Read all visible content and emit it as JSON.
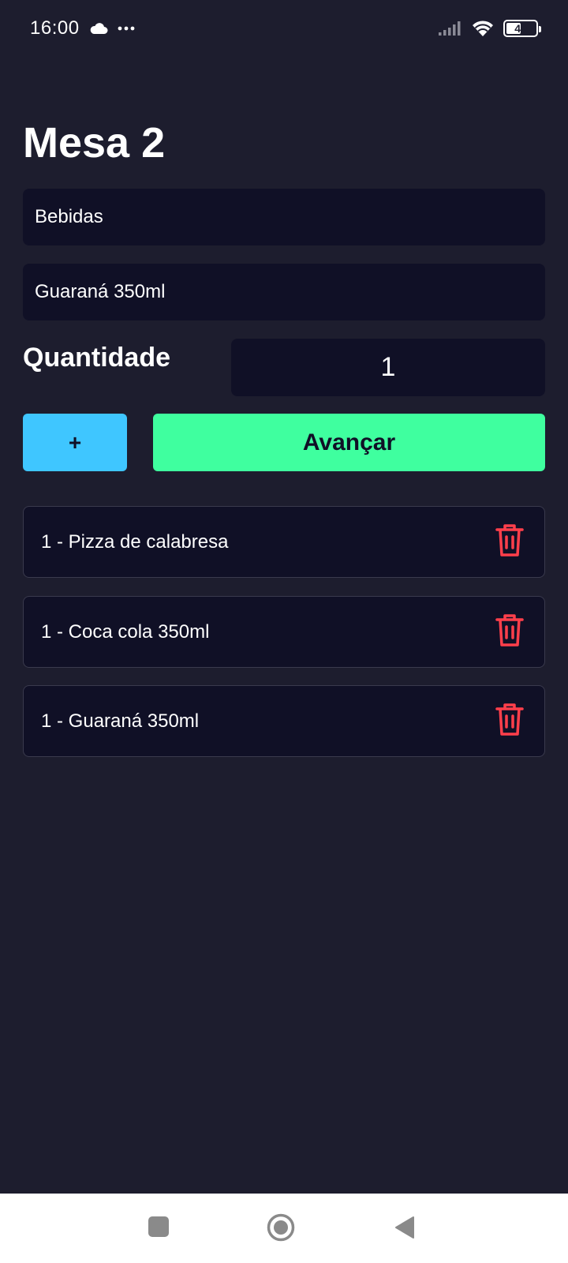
{
  "status_bar": {
    "time": "16:00",
    "battery_level": "49",
    "battery_fraction": 0.49,
    "icons": [
      "cloud-icon",
      "more-dots-icon",
      "signal-icon",
      "wifi-icon",
      "battery-icon"
    ]
  },
  "page": {
    "title": "Mesa 2"
  },
  "form": {
    "category_value": "Bebidas",
    "product_value": "Guaraná 350ml",
    "quantity_label": "Quantidade",
    "quantity_value": "1"
  },
  "actions": {
    "add_label": "+",
    "advance_label": "Avançar"
  },
  "items": [
    {
      "label": "1 - Pizza de calabresa",
      "action_icon": "trash-icon"
    },
    {
      "label": "1 - Coca cola 350ml",
      "action_icon": "trash-icon"
    },
    {
      "label": "1 - Guaraná 350ml",
      "action_icon": "trash-icon"
    }
  ],
  "colors": {
    "background": "#1d1d2e",
    "field": "#101026",
    "add_button": "#3fc6ff",
    "advance_button": "#3fff9f",
    "delete_icon": "#ff3f4b"
  },
  "nav_bar": {
    "icons": [
      "recents-square-icon",
      "home-circle-icon",
      "back-triangle-icon"
    ]
  }
}
